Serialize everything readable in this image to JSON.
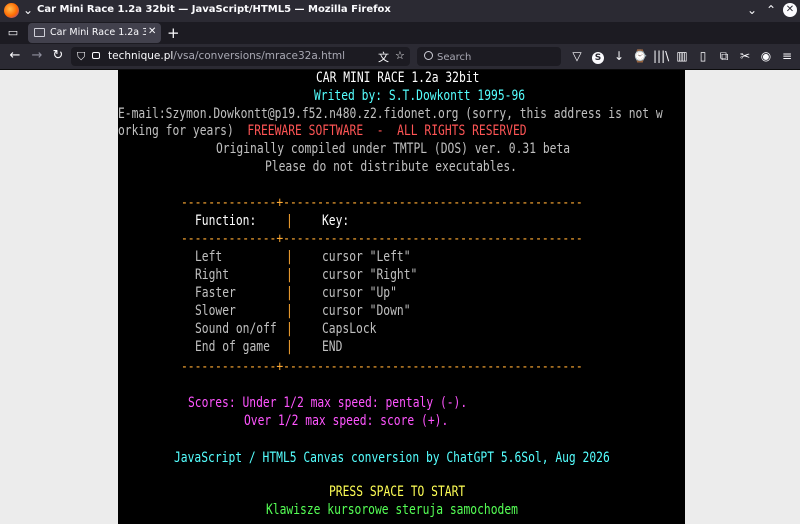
{
  "window": {
    "title": "Car Mini Race 1.2a 32bit — JavaScript/HTML5 — Mozilla Firefox"
  },
  "tab": {
    "label": "Car Mini Race 1.2a 32bit"
  },
  "url": {
    "host": "technique.pl",
    "path": "/vsa/conversions/mrace32a.html"
  },
  "search": {
    "placeholder": "Search"
  },
  "game": {
    "title": "CAR MINI RACE 1.2a 32bit",
    "author": "Writed by: S.T.Dowkontt 1995-96",
    "email_line1": "E-mail:Szymon.Dowkontt@p19.f52.n480.z2.fidonet.org (sorry, this address is not w",
    "email_line2_a": "orking for years)  ",
    "email_line2_b": "FREEWARE SOFTWARE  -  ALL RIGHTS RESERVED",
    "compiled": "Originally compiled under TMTPL (DOS) ver. 0.31 beta",
    "distribute": "Please do not distribute executables.",
    "table": {
      "rule_top": "--------------+--------------------------------------------",
      "header_function": "Function:",
      "header_key": "Key:",
      "rule_mid": "--------------+--------------------------------------------",
      "rows": [
        {
          "function": "Left",
          "key": "cursor \"Left\""
        },
        {
          "function": "Right",
          "key": "cursor \"Right\""
        },
        {
          "function": "Faster",
          "key": "cursor \"Up\""
        },
        {
          "function": "Slower",
          "key": "cursor \"Down\""
        },
        {
          "function": "Sound on/off",
          "key": "CapsLock"
        },
        {
          "function": "End of game",
          "key": "END"
        }
      ],
      "rule_bottom": "--------------+--------------------------------------------"
    },
    "scores_line1": "Scores: Under 1/2 max speed: pentaly (-).",
    "scores_line2": "Over 1/2 max speed: score (+).",
    "conversion": "JavaScript / HTML5 Canvas conversion by ChatGPT 5.6Sol, Aug 2026",
    "press_start": "PRESS SPACE TO START",
    "polish_hint": "Klawisze kursorowe steruja samochodem"
  },
  "colors": {
    "title": "#ffffff",
    "author": "#55ffff",
    "freeware": "#ff5555",
    "scores": "#ff55ff",
    "press_start": "#ffff55",
    "polish_hint": "#55ff55"
  }
}
